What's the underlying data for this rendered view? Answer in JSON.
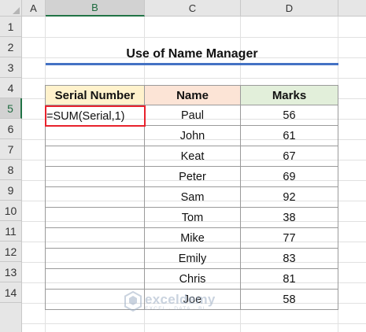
{
  "columns": [
    "A",
    "B",
    "C",
    "D"
  ],
  "rows": [
    "1",
    "2",
    "3",
    "4",
    "5",
    "6",
    "7",
    "8",
    "9",
    "10",
    "11",
    "12",
    "13",
    "14"
  ],
  "title": "Use of Name Manager",
  "headers": {
    "serial": "Serial Number",
    "name": "Name",
    "marks": "Marks"
  },
  "active_cell_formula": "=SUM(Serial,1)",
  "records": [
    {
      "name": "Paul",
      "marks": "56"
    },
    {
      "name": "John",
      "marks": "61"
    },
    {
      "name": "Keat",
      "marks": "67"
    },
    {
      "name": "Peter",
      "marks": "69"
    },
    {
      "name": "Sam",
      "marks": "92"
    },
    {
      "name": "Tom",
      "marks": "38"
    },
    {
      "name": "Mike",
      "marks": "77"
    },
    {
      "name": "Emily",
      "marks": "83"
    },
    {
      "name": "Chris",
      "marks": "81"
    },
    {
      "name": "Joe",
      "marks": "58"
    }
  ],
  "watermark": {
    "name": "exceldemy",
    "tagline": "EXCEL · DATA · BI",
    "icon": "exceldemy-logo-icon"
  },
  "colors": {
    "serial_header": "#fff2cc",
    "name_header": "#fce4d6",
    "marks_header": "#e2efda",
    "title_underline": "#4472c4",
    "active_border": "#e8222c",
    "excel_green": "#217346"
  }
}
